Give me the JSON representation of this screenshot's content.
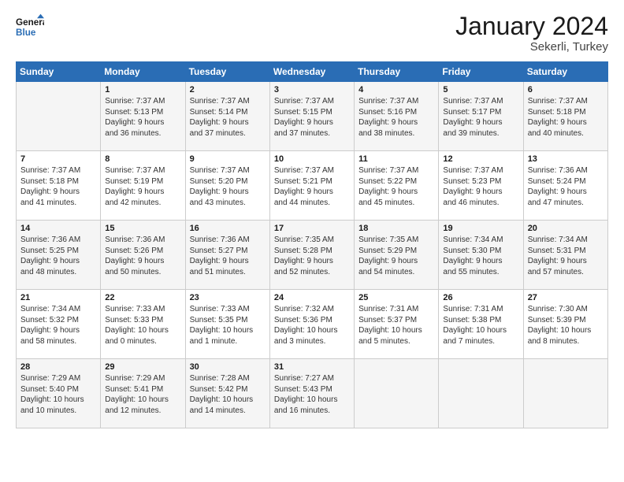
{
  "logo": {
    "line1": "General",
    "line2": "Blue"
  },
  "title": "January 2024",
  "location": "Sekerli, Turkey",
  "days_header": [
    "Sunday",
    "Monday",
    "Tuesday",
    "Wednesday",
    "Thursday",
    "Friday",
    "Saturday"
  ],
  "weeks": [
    [
      {
        "day": "",
        "content": ""
      },
      {
        "day": "1",
        "content": "Sunrise: 7:37 AM\nSunset: 5:13 PM\nDaylight: 9 hours\nand 36 minutes."
      },
      {
        "day": "2",
        "content": "Sunrise: 7:37 AM\nSunset: 5:14 PM\nDaylight: 9 hours\nand 37 minutes."
      },
      {
        "day": "3",
        "content": "Sunrise: 7:37 AM\nSunset: 5:15 PM\nDaylight: 9 hours\nand 37 minutes."
      },
      {
        "day": "4",
        "content": "Sunrise: 7:37 AM\nSunset: 5:16 PM\nDaylight: 9 hours\nand 38 minutes."
      },
      {
        "day": "5",
        "content": "Sunrise: 7:37 AM\nSunset: 5:17 PM\nDaylight: 9 hours\nand 39 minutes."
      },
      {
        "day": "6",
        "content": "Sunrise: 7:37 AM\nSunset: 5:18 PM\nDaylight: 9 hours\nand 40 minutes."
      }
    ],
    [
      {
        "day": "7",
        "content": "Sunrise: 7:37 AM\nSunset: 5:18 PM\nDaylight: 9 hours\nand 41 minutes."
      },
      {
        "day": "8",
        "content": "Sunrise: 7:37 AM\nSunset: 5:19 PM\nDaylight: 9 hours\nand 42 minutes."
      },
      {
        "day": "9",
        "content": "Sunrise: 7:37 AM\nSunset: 5:20 PM\nDaylight: 9 hours\nand 43 minutes."
      },
      {
        "day": "10",
        "content": "Sunrise: 7:37 AM\nSunset: 5:21 PM\nDaylight: 9 hours\nand 44 minutes."
      },
      {
        "day": "11",
        "content": "Sunrise: 7:37 AM\nSunset: 5:22 PM\nDaylight: 9 hours\nand 45 minutes."
      },
      {
        "day": "12",
        "content": "Sunrise: 7:37 AM\nSunset: 5:23 PM\nDaylight: 9 hours\nand 46 minutes."
      },
      {
        "day": "13",
        "content": "Sunrise: 7:36 AM\nSunset: 5:24 PM\nDaylight: 9 hours\nand 47 minutes."
      }
    ],
    [
      {
        "day": "14",
        "content": "Sunrise: 7:36 AM\nSunset: 5:25 PM\nDaylight: 9 hours\nand 48 minutes."
      },
      {
        "day": "15",
        "content": "Sunrise: 7:36 AM\nSunset: 5:26 PM\nDaylight: 9 hours\nand 50 minutes."
      },
      {
        "day": "16",
        "content": "Sunrise: 7:36 AM\nSunset: 5:27 PM\nDaylight: 9 hours\nand 51 minutes."
      },
      {
        "day": "17",
        "content": "Sunrise: 7:35 AM\nSunset: 5:28 PM\nDaylight: 9 hours\nand 52 minutes."
      },
      {
        "day": "18",
        "content": "Sunrise: 7:35 AM\nSunset: 5:29 PM\nDaylight: 9 hours\nand 54 minutes."
      },
      {
        "day": "19",
        "content": "Sunrise: 7:34 AM\nSunset: 5:30 PM\nDaylight: 9 hours\nand 55 minutes."
      },
      {
        "day": "20",
        "content": "Sunrise: 7:34 AM\nSunset: 5:31 PM\nDaylight: 9 hours\nand 57 minutes."
      }
    ],
    [
      {
        "day": "21",
        "content": "Sunrise: 7:34 AM\nSunset: 5:32 PM\nDaylight: 9 hours\nand 58 minutes."
      },
      {
        "day": "22",
        "content": "Sunrise: 7:33 AM\nSunset: 5:33 PM\nDaylight: 10 hours\nand 0 minutes."
      },
      {
        "day": "23",
        "content": "Sunrise: 7:33 AM\nSunset: 5:35 PM\nDaylight: 10 hours\nand 1 minute."
      },
      {
        "day": "24",
        "content": "Sunrise: 7:32 AM\nSunset: 5:36 PM\nDaylight: 10 hours\nand 3 minutes."
      },
      {
        "day": "25",
        "content": "Sunrise: 7:31 AM\nSunset: 5:37 PM\nDaylight: 10 hours\nand 5 minutes."
      },
      {
        "day": "26",
        "content": "Sunrise: 7:31 AM\nSunset: 5:38 PM\nDaylight: 10 hours\nand 7 minutes."
      },
      {
        "day": "27",
        "content": "Sunrise: 7:30 AM\nSunset: 5:39 PM\nDaylight: 10 hours\nand 8 minutes."
      }
    ],
    [
      {
        "day": "28",
        "content": "Sunrise: 7:29 AM\nSunset: 5:40 PM\nDaylight: 10 hours\nand 10 minutes."
      },
      {
        "day": "29",
        "content": "Sunrise: 7:29 AM\nSunset: 5:41 PM\nDaylight: 10 hours\nand 12 minutes."
      },
      {
        "day": "30",
        "content": "Sunrise: 7:28 AM\nSunset: 5:42 PM\nDaylight: 10 hours\nand 14 minutes."
      },
      {
        "day": "31",
        "content": "Sunrise: 7:27 AM\nSunset: 5:43 PM\nDaylight: 10 hours\nand 16 minutes."
      },
      {
        "day": "",
        "content": ""
      },
      {
        "day": "",
        "content": ""
      },
      {
        "day": "",
        "content": ""
      }
    ]
  ]
}
